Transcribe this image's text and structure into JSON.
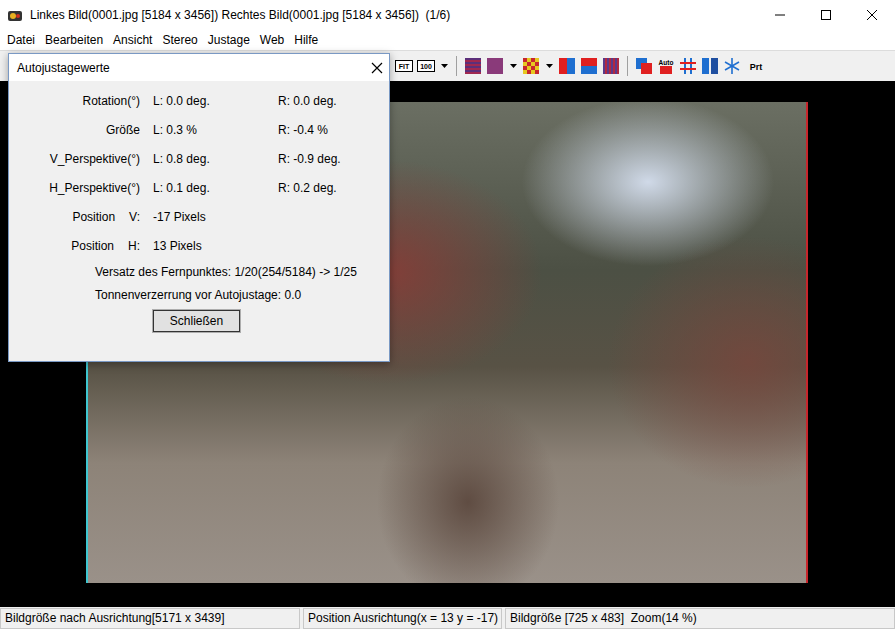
{
  "window": {
    "title": "Linkes Bild(0001.jpg [5184 x 3456]) Rechtes Bild(0001.jpg [5184 x 3456])  (1/6)"
  },
  "menu": [
    "Datei",
    "Bearbeiten",
    "Ansicht",
    "Stereo",
    "Justage",
    "Web",
    "Hilfe"
  ],
  "toolbar": [
    {
      "kind": "fit",
      "label": "FIT"
    },
    {
      "kind": "zoom",
      "label": "100"
    },
    {
      "kind": "dropdown"
    },
    {
      "kind": "separator"
    },
    {
      "kind": "interlaced"
    },
    {
      "kind": "anaglyph"
    },
    {
      "kind": "dropdown"
    },
    {
      "kind": "checker"
    },
    {
      "kind": "dropdown"
    },
    {
      "kind": "sidebyside"
    },
    {
      "kind": "overunder"
    },
    {
      "kind": "stripes"
    },
    {
      "kind": "separator"
    },
    {
      "kind": "overlap"
    },
    {
      "kind": "auto",
      "label": "Auto"
    },
    {
      "kind": "grid"
    },
    {
      "kind": "split"
    },
    {
      "kind": "snow"
    },
    {
      "kind": "print",
      "label": "Prt"
    }
  ],
  "dialog": {
    "title": "Autojustagewerte",
    "rows": [
      {
        "kind": "pair",
        "label": "Rotation(°)",
        "left": "L: 0.0 deg.",
        "right": "R: 0.0 deg."
      },
      {
        "kind": "pair",
        "label": "Größe",
        "left": "L: 0.3 %",
        "right": "R: -0.4 %"
      },
      {
        "kind": "pair",
        "label": "V_Perspektive(°)",
        "left": "L: 0.8 deg.",
        "right": "R: -0.9 deg."
      },
      {
        "kind": "pair",
        "label": "H_Perspektive(°)",
        "left": "L: 0.1 deg.",
        "right": "R: 0.2 deg."
      },
      {
        "kind": "single",
        "label": "Position",
        "axis": "V:",
        "value": "-17 Pixels"
      },
      {
        "kind": "single",
        "label": "Position",
        "axis": "H:",
        "value": "13 Pixels"
      }
    ],
    "notes": [
      "Versatz des Fernpunktes: 1/20(254/5184) -> 1/25",
      "Tonnenverzerrung vor Autojustage: 0.0"
    ],
    "button": "Schließen"
  },
  "status_bar": [
    "Bildgröße nach Ausrichtung[5171 x 3439]",
    "Position Ausrichtung(x = 13 y = -17)",
    "Bildgröße [725 x 483]  Zoom(14 %)"
  ]
}
